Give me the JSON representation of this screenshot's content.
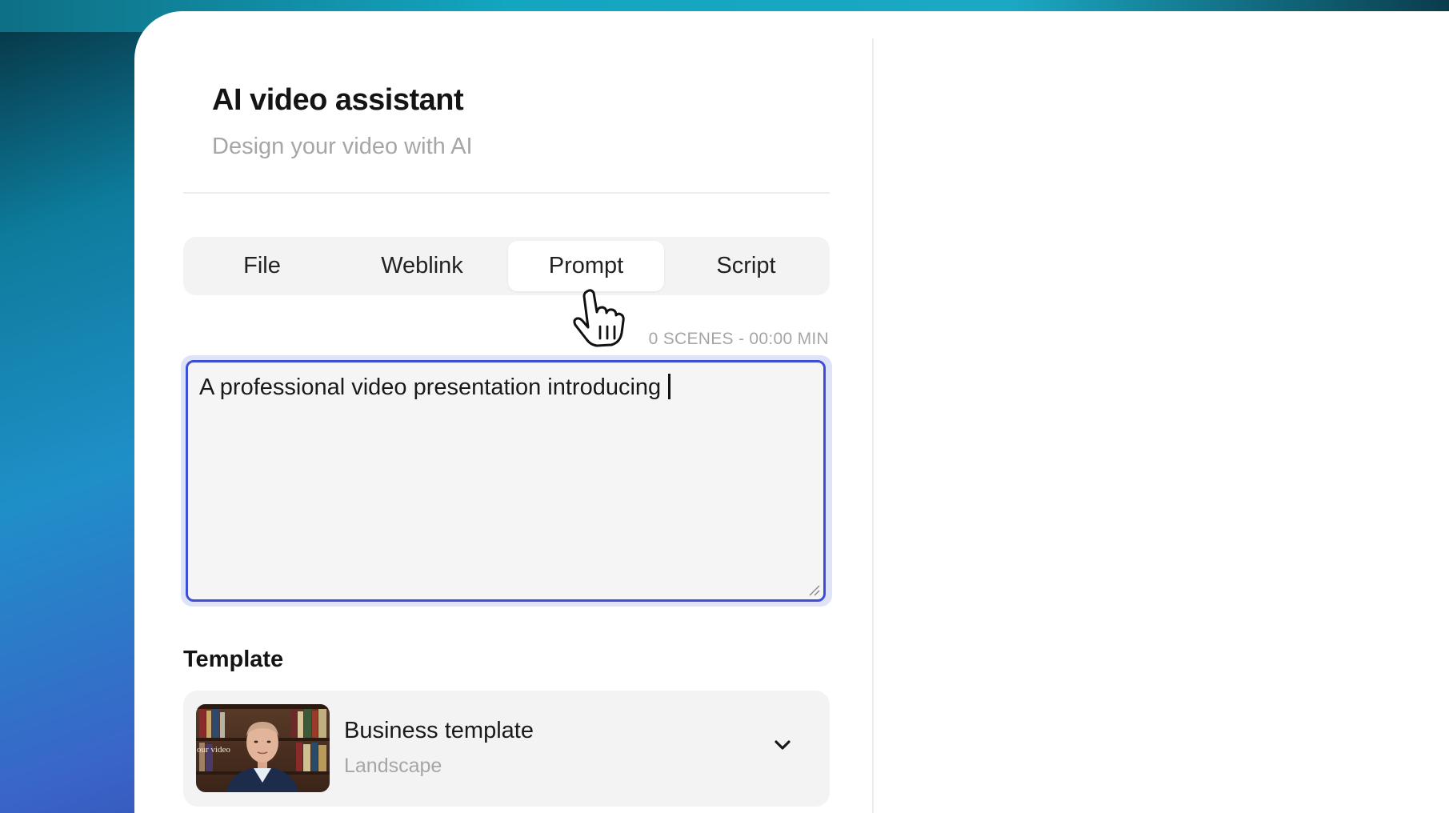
{
  "assistant": {
    "title": "AI video assistant",
    "subtitle": "Design your video with AI"
  },
  "tabs": [
    {
      "label": "File",
      "active": false
    },
    {
      "label": "Weblink",
      "active": false
    },
    {
      "label": "Prompt",
      "active": true
    },
    {
      "label": "Script",
      "active": false
    }
  ],
  "scene_counter": "0 SCENES - 00:00 MIN",
  "prompt": {
    "value": "A professional video presentation introducing"
  },
  "template": {
    "section_label": "Template",
    "name": "Business template",
    "orientation": "Landscape",
    "thumbnail_overlay_text": "our video"
  },
  "icons": {
    "dropdown": "chevron-down-icon",
    "cursor": "hand-pointer-icon",
    "resize": "resize-grip-icon"
  },
  "colors": {
    "accent": "#3d4fd6",
    "muted_text": "#a6a6a6",
    "panel_bg": "#ffffff",
    "control_bg": "#f3f3f3"
  }
}
